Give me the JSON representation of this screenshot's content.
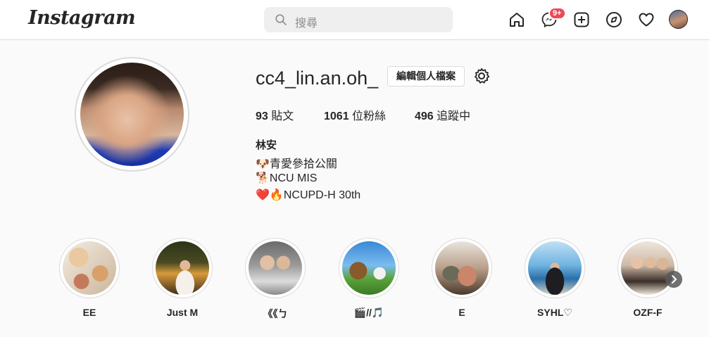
{
  "header": {
    "logo": "Instagram",
    "search_placeholder": "搜尋",
    "messages_badge": "9+"
  },
  "profile": {
    "username": "cc4_lin.an.oh_",
    "edit_button": "編輯個人檔案",
    "stats": {
      "posts_count": "93",
      "posts_label": "貼文",
      "followers_count": "1061",
      "followers_label": "位粉絲",
      "following_count": "496",
      "following_label": "追蹤中"
    },
    "full_name": "林安",
    "bio": [
      "🐶青愛參拾公關",
      "🐕NCU MIS",
      "❤️🔥NCUPD-H 30th"
    ]
  },
  "highlights": [
    {
      "label": "EE"
    },
    {
      "label": "Just M"
    },
    {
      "label": "《《ㄅ"
    },
    {
      "label": "🎬//🎵"
    },
    {
      "label": "E"
    },
    {
      "label": "SYHL♡"
    },
    {
      "label": "OZF-F"
    }
  ],
  "icons": {
    "home": "home-icon",
    "messenger": "messenger-icon",
    "new_post": "plus-square-icon",
    "explore": "compass-icon",
    "activity": "heart-icon",
    "settings": "gear-icon",
    "next": "chevron-right-icon"
  }
}
